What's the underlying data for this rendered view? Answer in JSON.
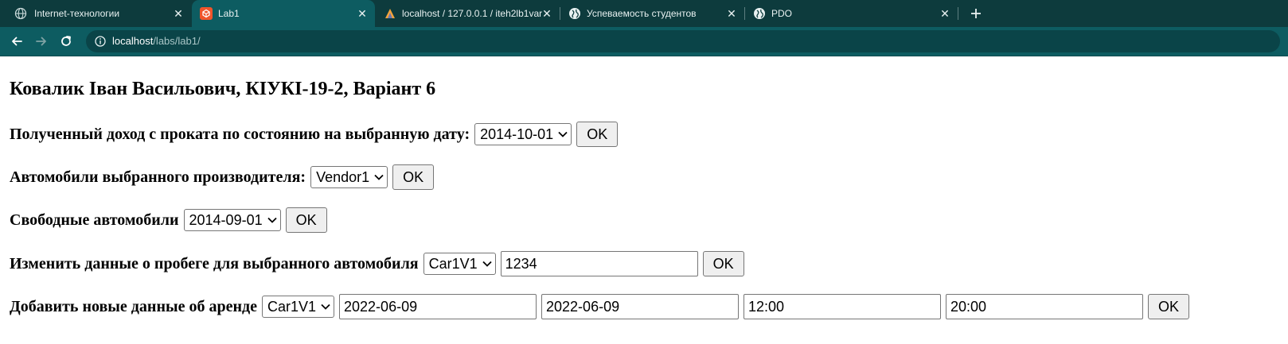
{
  "browser": {
    "tabs": [
      {
        "title": "Internet-технологии",
        "icon": "globe-icon",
        "active": false
      },
      {
        "title": "Lab1",
        "icon": "codepen-favicon",
        "active": true
      },
      {
        "title": "localhost / 127.0.0.1 / iteh2lb1var",
        "icon": "phpmyadmin-favicon",
        "active": false
      },
      {
        "title": "Успеваемость студентов",
        "icon": "globe-icon",
        "active": false
      },
      {
        "title": "PDO",
        "icon": "globe-icon",
        "active": false
      }
    ],
    "new_tab_icon": "plus-icon",
    "address": {
      "host": "localhost",
      "path": "/labs/lab1/",
      "icon": "info-icon"
    },
    "colors": {
      "tabstrip": "#0d3b3d",
      "toolbar": "#0d5c61",
      "active_tab_accent": "#f0542b"
    }
  },
  "page": {
    "heading": "Ковалик Іван Васильович, КІУКІ-19-2, Варіант 6",
    "rows": [
      {
        "label": "Полученный доход с проката по состоянию на выбранную дату:",
        "select": "2014-10-01",
        "inputs": [],
        "button": "OK"
      },
      {
        "label": "Автомобили выбранного производителя:",
        "select": "Vendor1",
        "inputs": [],
        "button": "OK"
      },
      {
        "label": "Свободные автомобили",
        "select": "2014-09-01",
        "inputs": [],
        "button": "OK"
      },
      {
        "label": "Изменить данные о пробеге для выбранного автомобиля",
        "select": "Car1V1",
        "inputs": [
          "1234"
        ],
        "button": "OK"
      },
      {
        "label": "Добавить новые данные об аренде",
        "select": "Car1V1",
        "inputs": [
          "2022-06-09",
          "2022-06-09",
          "12:00",
          "20:00"
        ],
        "button": "OK"
      }
    ]
  }
}
